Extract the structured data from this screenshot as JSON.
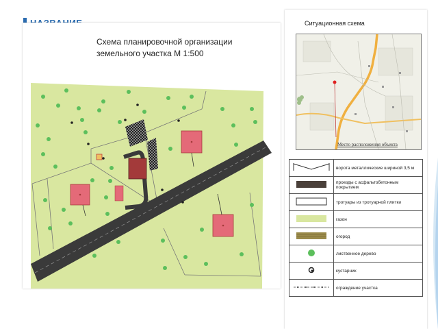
{
  "slide": {
    "header": "НАЗВАНИЕ"
  },
  "main_plan": {
    "title_line1": "Схема планировочной организации",
    "title_line2": "земельного участка М 1:500"
  },
  "situation": {
    "title": "Ситуационная схема",
    "caption": "Место расположения объекта"
  },
  "legend": [
    {
      "symbol": "gate-icon",
      "label": "ворота металлические шириной 3,5 м"
    },
    {
      "symbol": "asphalt-swatch",
      "label": "проезды с асфальтобетонным покрытием"
    },
    {
      "symbol": "sidewalk-swatch",
      "label": "тротуары из тротуарной плитки"
    },
    {
      "symbol": "lawn-swatch",
      "label": "газон"
    },
    {
      "symbol": "garden-swatch",
      "label": "огород"
    },
    {
      "symbol": "tree-icon",
      "label": "лиственное дерево"
    },
    {
      "symbol": "shrub-icon",
      "label": "кустарник"
    },
    {
      "symbol": "fence-icon",
      "label": "ограждение участка"
    }
  ],
  "colors": {
    "lawn": "#d9e7a0",
    "road": "#3a3a3a",
    "building": "#e46a78",
    "house": "#a33a3a",
    "tree": "#5cbf5c",
    "header": "#2b6cb0"
  }
}
